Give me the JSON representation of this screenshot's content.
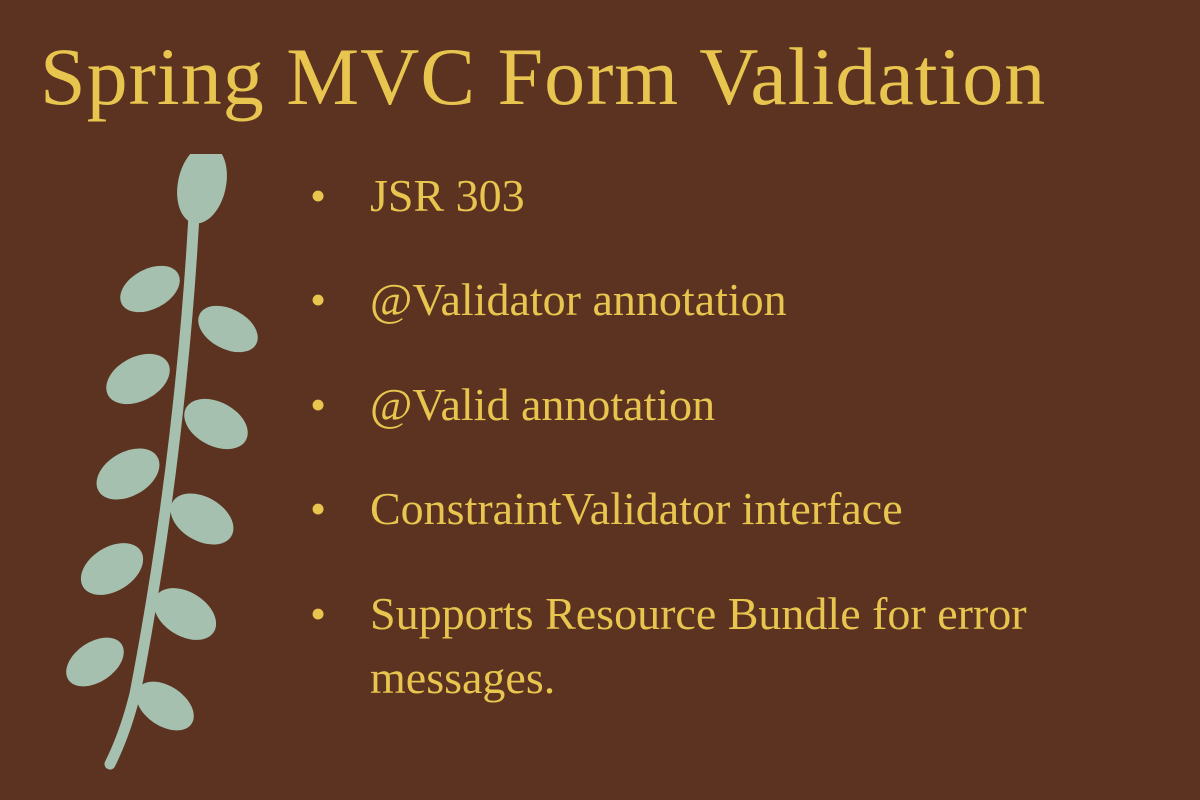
{
  "title": "Spring MVC Form Validation",
  "bullets": {
    "item0": "JSR 303",
    "item1": "@Validator annotation",
    "item2": "@Valid annotation",
    "item3": "ConstraintValidator interface",
    "item4": "Supports Resource Bundle for error messages."
  },
  "colors": {
    "background": "#5b3320",
    "text": "#e8c54f",
    "plant": "#a5c0ae"
  }
}
